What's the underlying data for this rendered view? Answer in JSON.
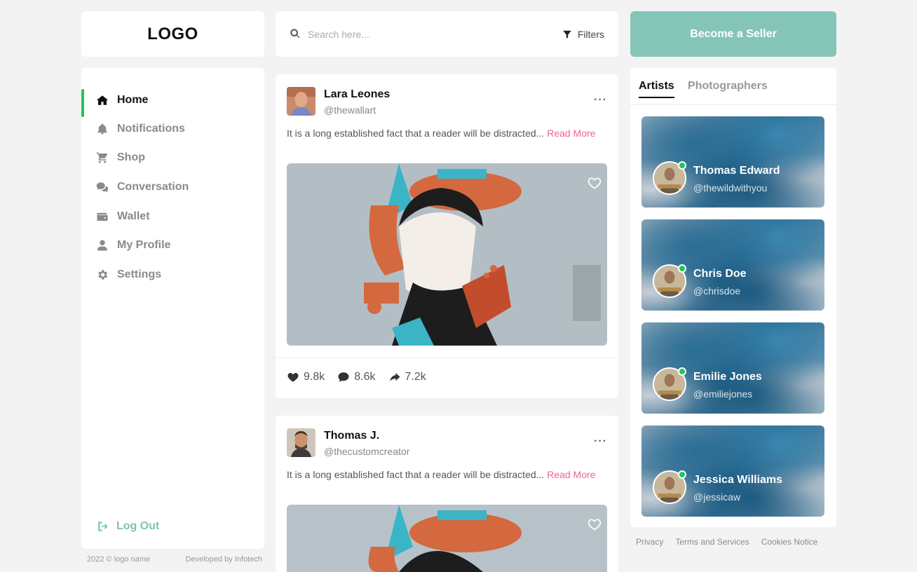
{
  "logo": {
    "text": "LOGO"
  },
  "sidebar": {
    "items": [
      {
        "label": "Home",
        "icon": "home-icon",
        "active": true
      },
      {
        "label": "Notifications",
        "icon": "bell-icon"
      },
      {
        "label": "Shop",
        "icon": "cart-icon"
      },
      {
        "label": "Conversation",
        "icon": "chat-icon"
      },
      {
        "label": "Wallet",
        "icon": "wallet-icon"
      },
      {
        "label": "My Profile",
        "icon": "user-icon"
      },
      {
        "label": "Settings",
        "icon": "gear-icon"
      }
    ],
    "logout_label": "Log Out"
  },
  "footer_left": {
    "copyright": "2022 © logo name",
    "developer": "Developed by Infotech"
  },
  "search": {
    "placeholder": "Search here...",
    "filters_label": "Filters"
  },
  "posts": [
    {
      "name": "Lara Leones",
      "handle": "@thewallart",
      "text": "It is a long established fact that a reader will be distracted...",
      "read_more": "Read More",
      "likes": "9.8k",
      "comments": "8.6k",
      "shares": "7.2k"
    },
    {
      "name": "Thomas J.",
      "handle": "@thecustomcreator",
      "text": "It is a long established fact that a reader will be distracted...",
      "read_more": "Read More"
    }
  ],
  "seller": {
    "label": "Become a Seller"
  },
  "tabs": {
    "artists": "Artists",
    "photographers": "Photographers"
  },
  "artists": [
    {
      "name": "Thomas Edward",
      "handle": "@thewildwithyou"
    },
    {
      "name": "Chris Doe",
      "handle": "@chrisdoe"
    },
    {
      "name": "Emilie Jones",
      "handle": "@emiliejones"
    },
    {
      "name": "Jessica Williams",
      "handle": "@jessicaw"
    }
  ],
  "footer_right": {
    "privacy": "Privacy",
    "terms": "Terms and Services",
    "cookies": "Cookies Notice"
  },
  "colors": {
    "accent_green": "#22c55e",
    "seller_teal": "#85c5b8",
    "read_more_pink": "#f06292"
  }
}
